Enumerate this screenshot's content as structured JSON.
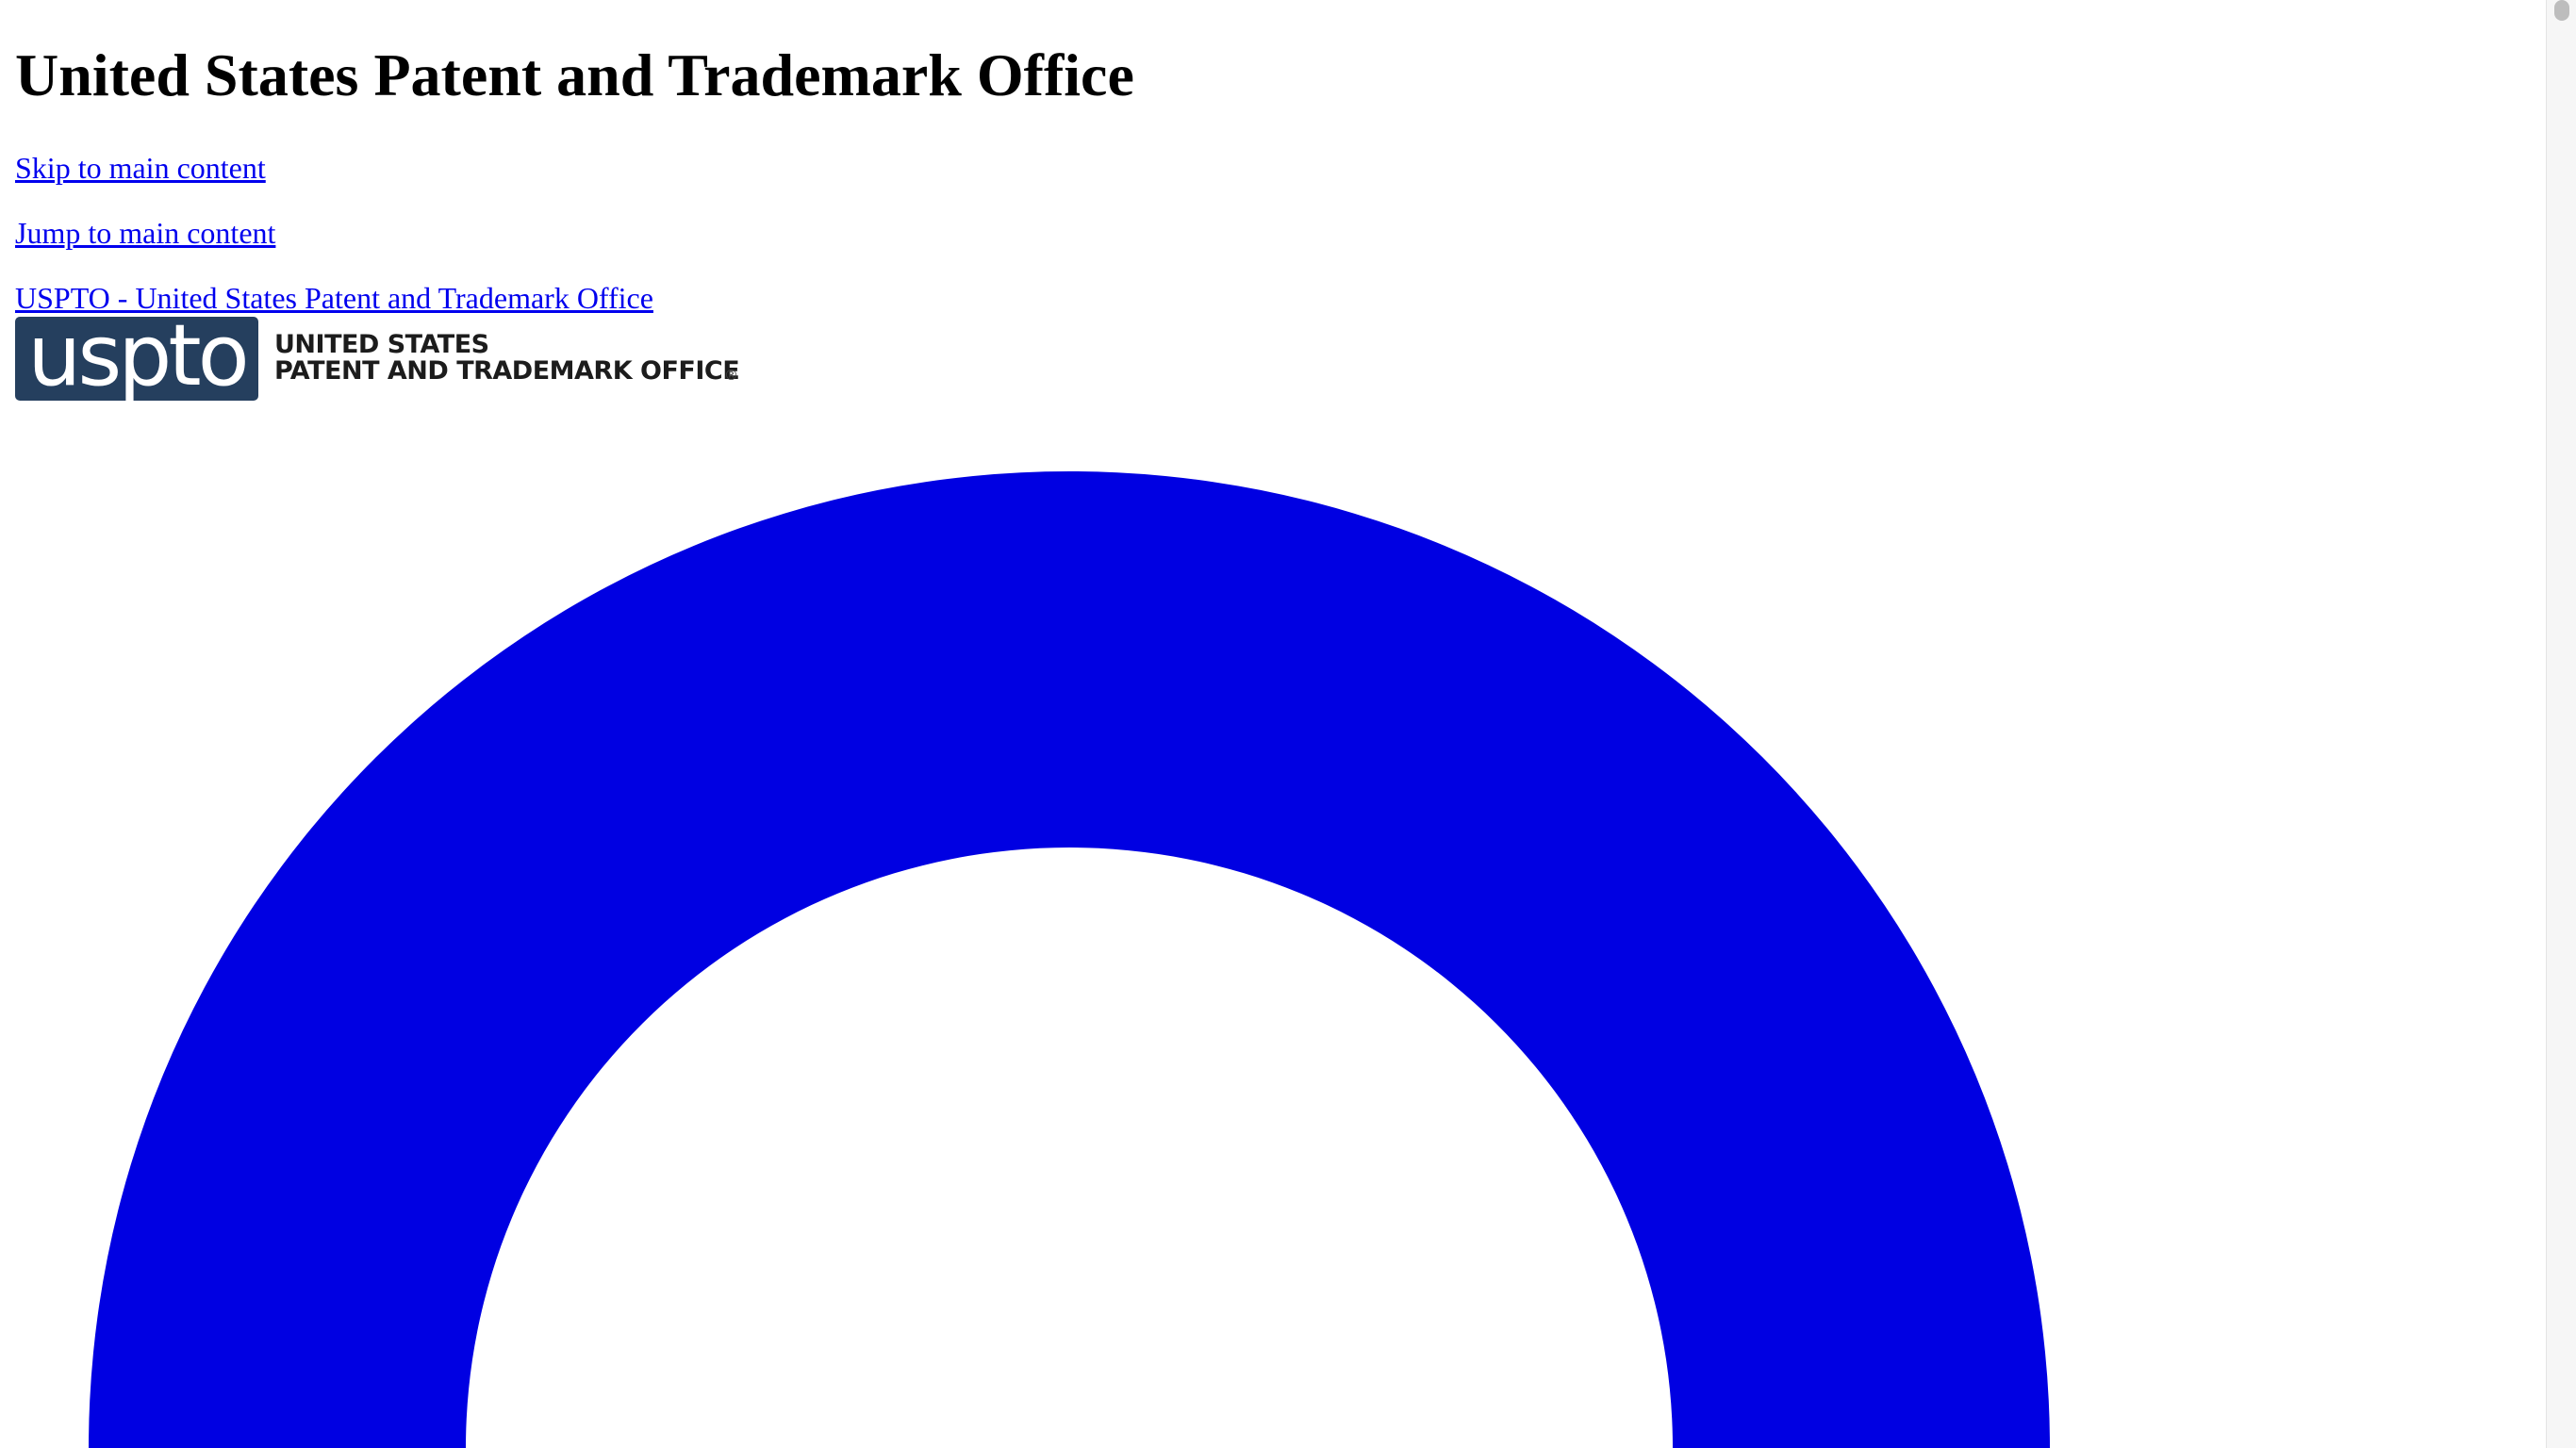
{
  "page": {
    "title": "United States Patent and Trademark Office"
  },
  "links": {
    "skip": "Skip to main content",
    "jump": "Jump to main content",
    "home": "USPTO - United States Patent and Trademark Office"
  },
  "logo": {
    "mark": "uspto",
    "line1": "UNITED STATES",
    "line2": "PATENT AND TRADEMARK OFFICE",
    "reg": "®"
  },
  "colors": {
    "link": "#0000ee",
    "spinner": "#0000e2",
    "logo_box": "#253f5e",
    "background": "#ffffff"
  },
  "icons": {
    "loading": "loading-spinner-icon"
  }
}
